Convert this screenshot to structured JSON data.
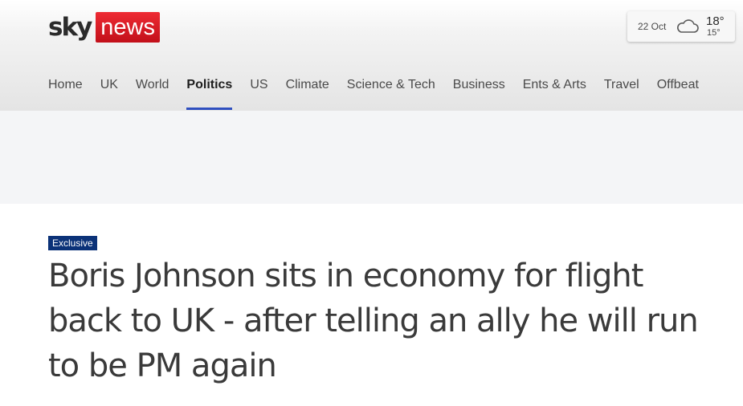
{
  "logo": {
    "sky": "sky",
    "news": "news"
  },
  "weather": {
    "date": "22 Oct",
    "icon": "cloud-icon",
    "high": "18°",
    "low": "15°"
  },
  "nav": {
    "items": [
      {
        "label": "Home"
      },
      {
        "label": "UK"
      },
      {
        "label": "World"
      },
      {
        "label": "Politics",
        "active": true
      },
      {
        "label": "US"
      },
      {
        "label": "Climate"
      },
      {
        "label": "Science & Tech"
      },
      {
        "label": "Business"
      },
      {
        "label": "Ents & Arts"
      },
      {
        "label": "Travel"
      },
      {
        "label": "Offbeat"
      }
    ]
  },
  "article": {
    "badge": "Exclusive",
    "headline": "Boris Johnson sits in economy for flight back to UK - after telling an ally he will run to be PM again"
  },
  "colors": {
    "brand_red": "#d7141f",
    "nav_active_underline": "#2f4fbf",
    "badge_bg": "#0b3278"
  }
}
